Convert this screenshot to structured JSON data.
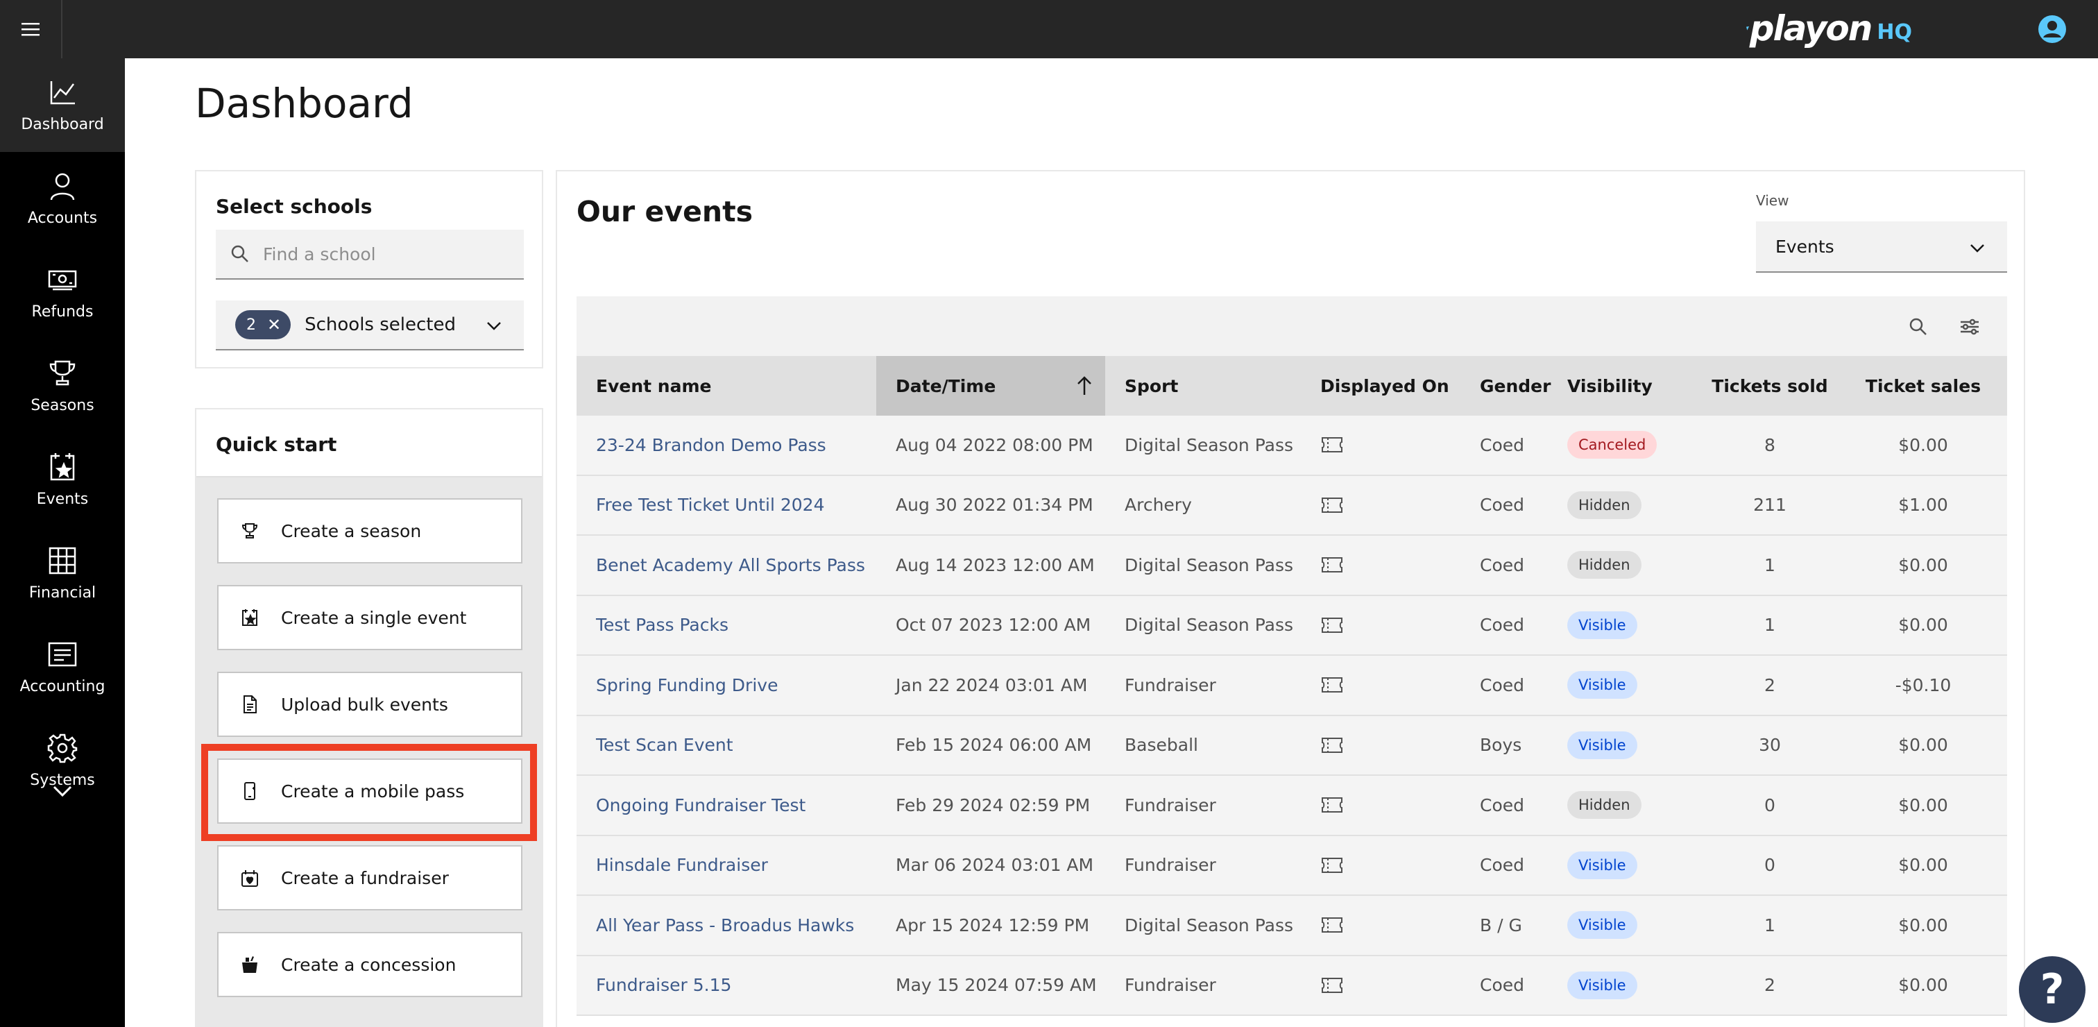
{
  "brand": {
    "logo_text": "playon",
    "logo_suffix": "HQ",
    "accent": "#5ac8fa"
  },
  "sidebar": {
    "items": [
      {
        "label": "Dashboard",
        "icon": "chart-line-icon"
      },
      {
        "label": "Accounts",
        "icon": "user-icon"
      },
      {
        "label": "Refunds",
        "icon": "money-icon"
      },
      {
        "label": "Seasons",
        "icon": "trophy-icon"
      },
      {
        "label": "Events",
        "icon": "calendar-star-icon"
      },
      {
        "label": "Financial",
        "icon": "grid-table-icon"
      },
      {
        "label": "Accounting",
        "icon": "ledger-icon"
      },
      {
        "label": "Systems",
        "icon": "gear-icon"
      }
    ]
  },
  "page": {
    "title": "Dashboard"
  },
  "schools": {
    "heading": "Select schools",
    "search_placeholder": "Find a school",
    "selected_count": "2",
    "selected_label": "Schools selected"
  },
  "quick_start": {
    "heading": "Quick start",
    "items": [
      {
        "label": "Create a season",
        "icon": "trophy-icon"
      },
      {
        "label": "Create a single event",
        "icon": "calendar-star-icon"
      },
      {
        "label": "Upload bulk events",
        "icon": "document-icon"
      },
      {
        "label": "Create a mobile pass",
        "icon": "mobile-pass-icon"
      },
      {
        "label": "Create a fundraiser",
        "icon": "fundraiser-icon"
      },
      {
        "label": "Create a concession",
        "icon": "concession-icon"
      }
    ]
  },
  "events": {
    "title": "Our events",
    "view_label": "View",
    "view_value": "Events",
    "columns": [
      "Event name",
      "Date/Time",
      "Sport",
      "Displayed On",
      "Gender",
      "Visibility",
      "Tickets sold",
      "Ticket sales"
    ],
    "rows": [
      {
        "name": "23-24 Brandon Demo Pass",
        "date": "Aug 04 2022 08:00 PM",
        "sport": "Digital Season Pass",
        "gender": "Coed",
        "visibility": "Canceled",
        "sold": "8",
        "sales": "$0.00"
      },
      {
        "name": "Free Test Ticket Until 2024",
        "date": "Aug 30 2022 01:34 PM",
        "sport": "Archery",
        "gender": "Coed",
        "visibility": "Hidden",
        "sold": "211",
        "sales": "$1.00"
      },
      {
        "name": "Benet Academy All Sports Pass",
        "date": "Aug 14 2023 12:00 AM",
        "sport": "Digital Season Pass",
        "gender": "Coed",
        "visibility": "Hidden",
        "sold": "1",
        "sales": "$0.00"
      },
      {
        "name": "Test Pass Packs",
        "date": "Oct 07 2023 12:00 AM",
        "sport": "Digital Season Pass",
        "gender": "Coed",
        "visibility": "Visible",
        "sold": "1",
        "sales": "$0.00"
      },
      {
        "name": "Spring Funding Drive",
        "date": "Jan 22 2024 03:01 AM",
        "sport": "Fundraiser",
        "gender": "Coed",
        "visibility": "Visible",
        "sold": "2",
        "sales": "-$0.10"
      },
      {
        "name": "Test Scan Event",
        "date": "Feb 15 2024 06:00 AM",
        "sport": "Baseball",
        "gender": "Boys",
        "visibility": "Visible",
        "sold": "30",
        "sales": "$0.00"
      },
      {
        "name": "Ongoing Fundraiser Test",
        "date": "Feb 29 2024 02:59 PM",
        "sport": "Fundraiser",
        "gender": "Coed",
        "visibility": "Hidden",
        "sold": "0",
        "sales": "$0.00"
      },
      {
        "name": "Hinsdale Fundraiser",
        "date": "Mar 06 2024 03:01 AM",
        "sport": "Fundraiser",
        "gender": "Coed",
        "visibility": "Visible",
        "sold": "0",
        "sales": "$0.00"
      },
      {
        "name": "All Year Pass - Broadus Hawks",
        "date": "Apr 15 2024 12:59 PM",
        "sport": "Digital Season Pass",
        "gender": "B / G",
        "visibility": "Visible",
        "sold": "1",
        "sales": "$0.00"
      },
      {
        "name": "Fundraiser 5.15",
        "date": "May 15 2024 07:59 AM",
        "sport": "Fundraiser",
        "gender": "Coed",
        "visibility": "Visible",
        "sold": "2",
        "sales": "$0.00"
      }
    ]
  },
  "help": {
    "label": "?"
  }
}
